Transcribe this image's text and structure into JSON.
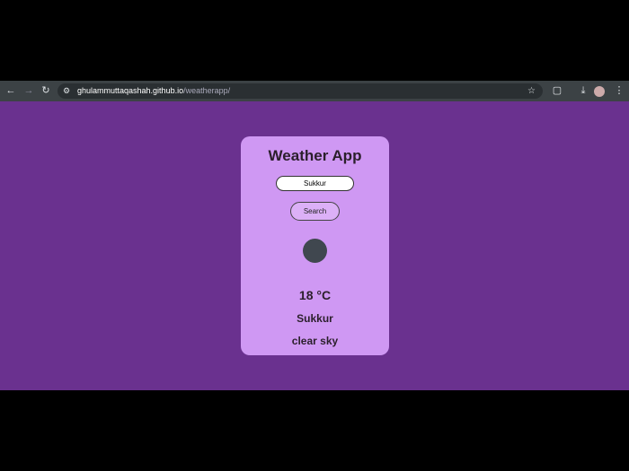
{
  "browser": {
    "url_host": "ghulammuttaqashah.github.io",
    "url_path": "/weatherapp/"
  },
  "app": {
    "title": "Weather App",
    "search_value": "Sukkur",
    "search_button": "Search",
    "temperature": "18 °C",
    "city": "Sukkur",
    "description": "clear sky"
  }
}
